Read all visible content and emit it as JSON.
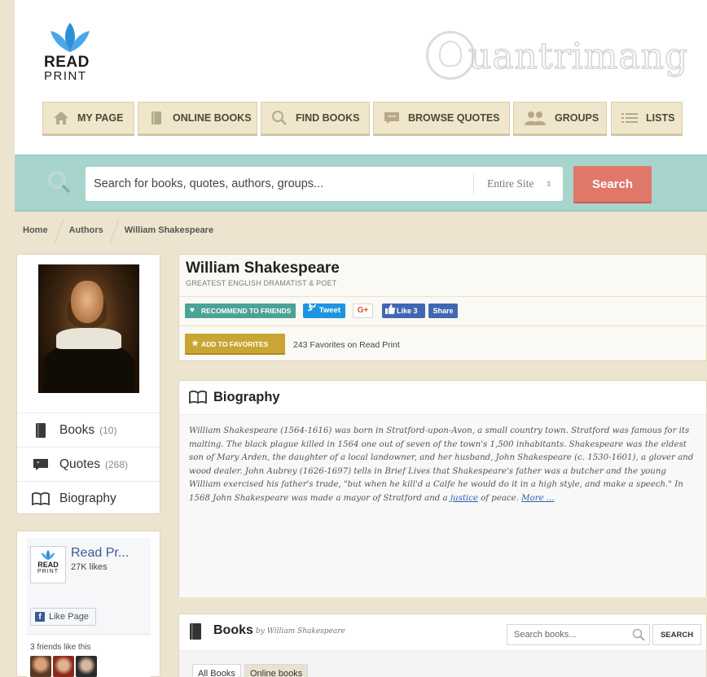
{
  "logo": {
    "line1": "READ",
    "line2": "PRINT"
  },
  "watermark": {
    "text": "uantrimang"
  },
  "nav": [
    {
      "label": "MY PAGE",
      "icon": "home-icon"
    },
    {
      "label": "ONLINE BOOKS",
      "icon": "book-icon"
    },
    {
      "label": "FIND BOOKS",
      "icon": "search-icon"
    },
    {
      "label": "BROWSE QUOTES",
      "icon": "quote-icon"
    },
    {
      "label": "GROUPS",
      "icon": "groups-icon"
    },
    {
      "label": "LISTS",
      "icon": "list-icon"
    }
  ],
  "search": {
    "placeholder": "Search for books, quotes, authors, groups...",
    "scope": "Entire Site",
    "button": "Search"
  },
  "breadcrumb": [
    "Home",
    "Authors",
    "William Shakespeare"
  ],
  "sidebar": {
    "items": [
      {
        "label": "Books",
        "count": "(10)",
        "icon": "book-icon"
      },
      {
        "label": "Quotes",
        "count": "(268)",
        "icon": "quote-icon"
      },
      {
        "label": "Biography",
        "count": "",
        "icon": "open-book-icon"
      }
    ]
  },
  "facebook": {
    "logo_line1": "READ",
    "logo_line2": "PRINT",
    "title": "Read Pr...",
    "likes": "27K likes",
    "like_page": "Like Page",
    "friends": "3 friends like this"
  },
  "author": {
    "name": "William Shakespeare",
    "subtitle": "GREATEST ENGLISH DRAMATIST & POET",
    "recommend": "RECOMMEND TO FRIENDS",
    "tweet": "Tweet",
    "gplus": "G+",
    "like": "Like 3",
    "share": "Share",
    "add_favorites": "ADD TO FAVORITES",
    "favorites_count": "243 Favorites on Read Print"
  },
  "biography": {
    "title": "Biography",
    "text_before_link": "William Shakespeare (1564-1616) was born in Stratford-upon-Avon, a small country town. Stratford was famous for its malting. The black plague killed in 1564 one out of seven of the town's 1,500 inhabitants. Shakespeare was the eldest son of Mary Arden, the daughter of a local landowner, and her husband, John Shakespeare (c. 1530-1601), a glover and wood dealer. John Aubrey (1626-1697) tells in Brief Lives that Shakespeare's father was a butcher and the young William exercised his father's trade, \"but when he kill'd a Calfe he would do it in a high style, and make a speech.\" In 1568 John Shakespeare was made a mayor of Stratford and a ",
    "link_word": "justice",
    "text_after_link": " of peace. ",
    "more": "More ..."
  },
  "books": {
    "title": "Books",
    "subtitle": "by William Shakespeare",
    "tab_all": "All Books",
    "tab_online": "Online books",
    "search_placeholder": "Search books...",
    "search_button": "SEARCH"
  },
  "colors": {
    "background": "#ece4cf",
    "search_bar": "#a7d4cc",
    "search_button": "#e0786a",
    "recommend": "#4ba396",
    "favorites": "#c9a633",
    "facebook": "#4267b2",
    "twitter": "#1b95e0"
  }
}
